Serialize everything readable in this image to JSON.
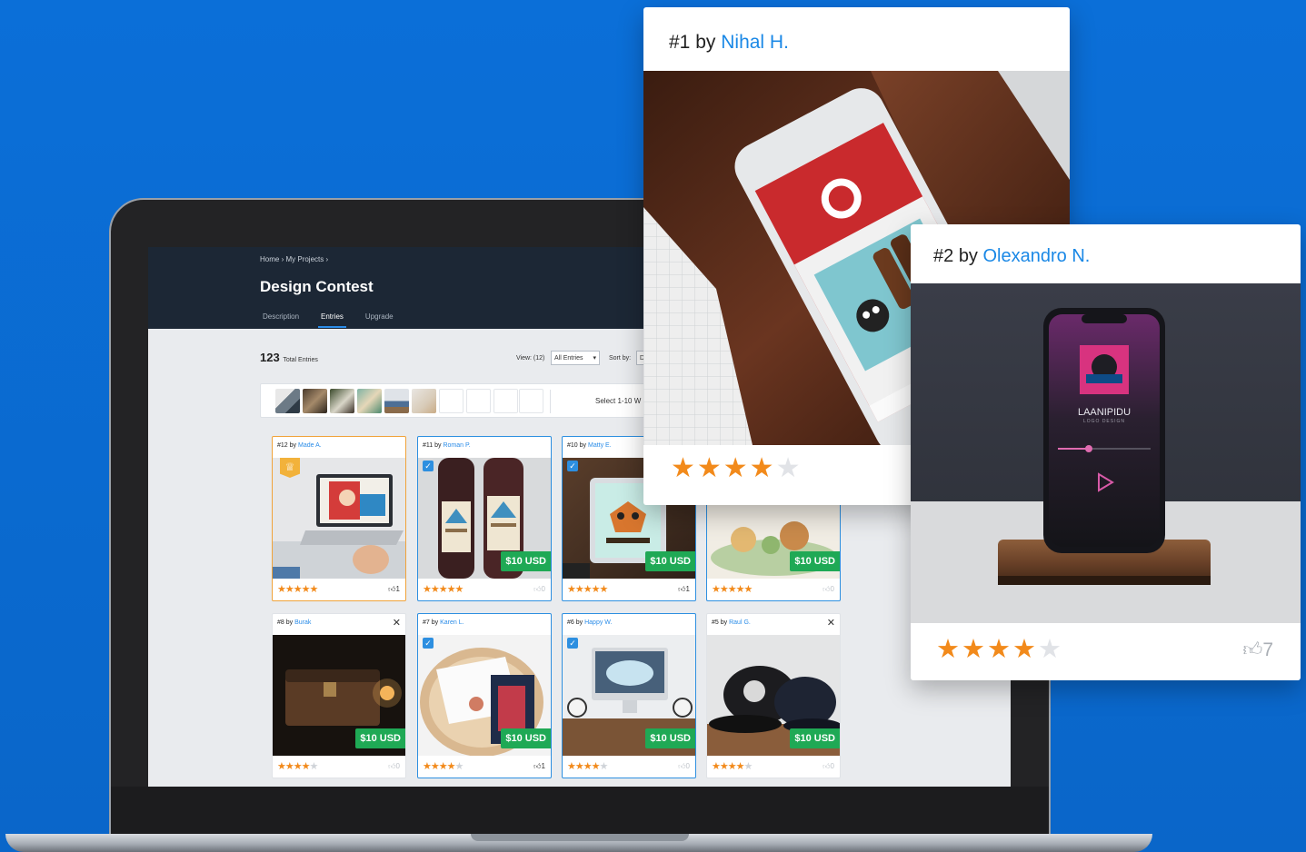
{
  "screen": {
    "breadcrumb": [
      "Home",
      "My Projects"
    ],
    "title": "Design Contest",
    "tabs": [
      {
        "label": "Description",
        "active": false
      },
      {
        "label": "Entries",
        "active": true
      },
      {
        "label": "Upgrade",
        "active": false
      }
    ],
    "entries_count": "123",
    "entries_label": "Total Entries",
    "view_label": "View: (12)",
    "view_value": "All Entries",
    "sort_label": "Sort by:",
    "sort_value": "D",
    "select_range": "Select 1-10 W",
    "cards": [
      {
        "num": "#12",
        "by": "by",
        "author": "Made A.",
        "rating": 5,
        "likes": "1",
        "price": "",
        "checked": false,
        "trophy": true,
        "close": false
      },
      {
        "num": "#11",
        "by": "by",
        "author": "Roman P.",
        "rating": 5,
        "likes": "0",
        "price": "$10 USD",
        "checked": true,
        "trophy": false,
        "close": false
      },
      {
        "num": "#10",
        "by": "by",
        "author": "Matty E.",
        "rating": 5,
        "likes": "1",
        "price": "$10 USD",
        "checked": true,
        "trophy": false,
        "close": false
      },
      {
        "num": "",
        "by": "",
        "author": "",
        "rating": 5,
        "likes": "0",
        "price": "$10 USD",
        "checked": false,
        "trophy": false,
        "close": false
      },
      {
        "num": "#8",
        "by": "by",
        "author": "Burak",
        "rating": 4,
        "likes": "0",
        "price": "$10 USD",
        "checked": false,
        "trophy": false,
        "close": true
      },
      {
        "num": "#7",
        "by": "by",
        "author": "Karen L.",
        "rating": 4,
        "likes": "1",
        "price": "$10 USD",
        "checked": true,
        "trophy": false,
        "close": false
      },
      {
        "num": "#6",
        "by": "by",
        "author": "Happy W.",
        "rating": 4,
        "likes": "0",
        "price": "$10 USD",
        "checked": true,
        "trophy": false,
        "close": false
      },
      {
        "num": "#5",
        "by": "by",
        "author": "Raul G.",
        "rating": 4,
        "likes": "0",
        "price": "$10 USD",
        "checked": false,
        "trophy": false,
        "close": true
      }
    ]
  },
  "popup1": {
    "num": "#1",
    "by": "by",
    "author": "Nihal H.",
    "rating": 4
  },
  "popup2": {
    "num": "#2",
    "by": "by",
    "author": "Olexandro N.",
    "rating": 4,
    "likes": "7"
  },
  "phone2": {
    "brand": "LAANIPIDU",
    "subtitle": "LOGO DESIGN"
  },
  "colors": {
    "background": "#0a6fd6",
    "accent": "#2a8ce8",
    "star": "#f28a1b",
    "price": "#1fa955"
  }
}
